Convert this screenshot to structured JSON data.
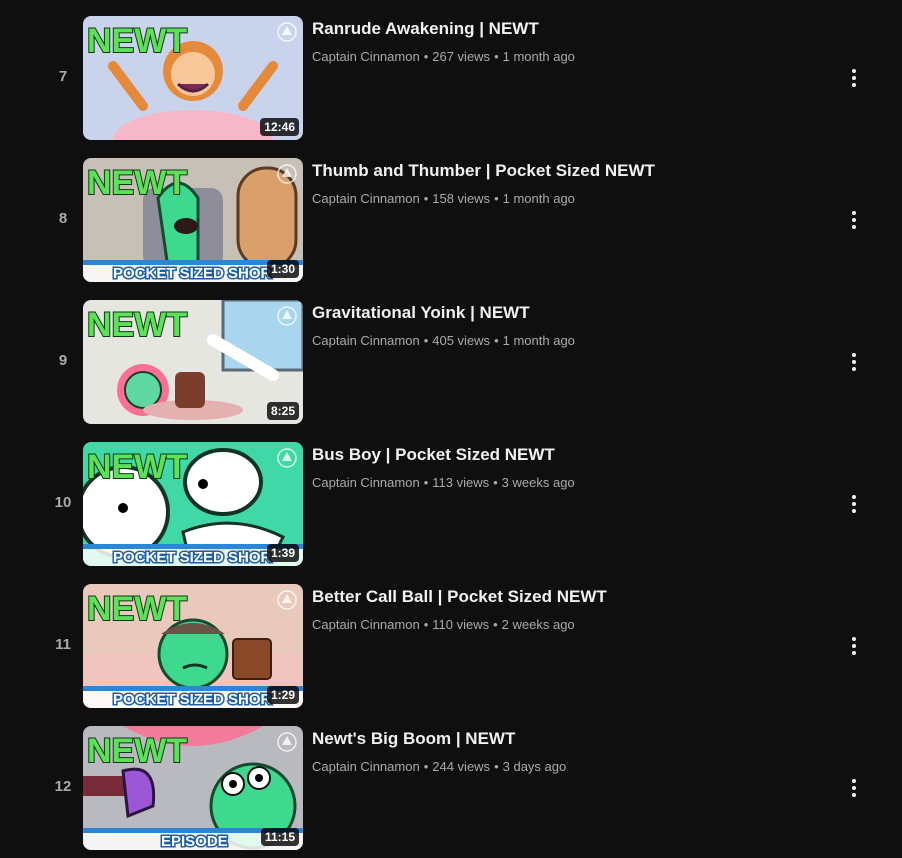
{
  "videos": [
    {
      "index": "7",
      "title": "Ranrude Awakening | NEWT",
      "channel": "Captain Cinnamon",
      "views": "267 views",
      "age": "1 month ago",
      "duration": "12:46",
      "thumb_logo": "NEWT",
      "thumb_banner": "",
      "thumb_bg": "#c9d4ec"
    },
    {
      "index": "8",
      "title": "Thumb and Thumber | Pocket Sized NEWT",
      "channel": "Captain Cinnamon",
      "views": "158 views",
      "age": "1 month ago",
      "duration": "1:30",
      "thumb_logo": "NEWT",
      "thumb_banner": "POCKET SIZED SHOR",
      "thumb_bg": "#c7c0b6"
    },
    {
      "index": "9",
      "title": "Gravitational Yoink | NEWT",
      "channel": "Captain Cinnamon",
      "views": "405 views",
      "age": "1 month ago",
      "duration": "8:25",
      "thumb_logo": "NEWT",
      "thumb_banner": "",
      "thumb_bg": "#e4e6df"
    },
    {
      "index": "10",
      "title": "Bus Boy | Pocket Sized NEWT",
      "channel": "Captain Cinnamon",
      "views": "113 views",
      "age": "3 weeks ago",
      "duration": "1:39",
      "thumb_logo": "NEWT",
      "thumb_banner": "POCKET SIZED SHOR",
      "thumb_bg": "#3fd8a6"
    },
    {
      "index": "11",
      "title": "Better Call Ball | Pocket Sized NEWT",
      "channel": "Captain Cinnamon",
      "views": "110 views",
      "age": "2 weeks ago",
      "duration": "1:29",
      "thumb_logo": "NEWT",
      "thumb_banner": "POCKET SIZED SHOR",
      "thumb_bg": "#e9c9bb"
    },
    {
      "index": "12",
      "title": "Newt's Big Boom | NEWT",
      "channel": "Captain Cinnamon",
      "views": "244 views",
      "age": "3 days ago",
      "duration": "11:15",
      "thumb_logo": "NEWT",
      "thumb_banner": "EPISODE",
      "thumb_bg": "#b9b9c0"
    }
  ],
  "separator": "•",
  "colors": {
    "background": "#0f0f0f",
    "title": "#f1f1f1",
    "secondary": "#aaaaaa",
    "logo_green": "#5ee05b",
    "banner_blue": "#2b86d6"
  },
  "icons": {
    "menu": "more-vert-icon"
  }
}
